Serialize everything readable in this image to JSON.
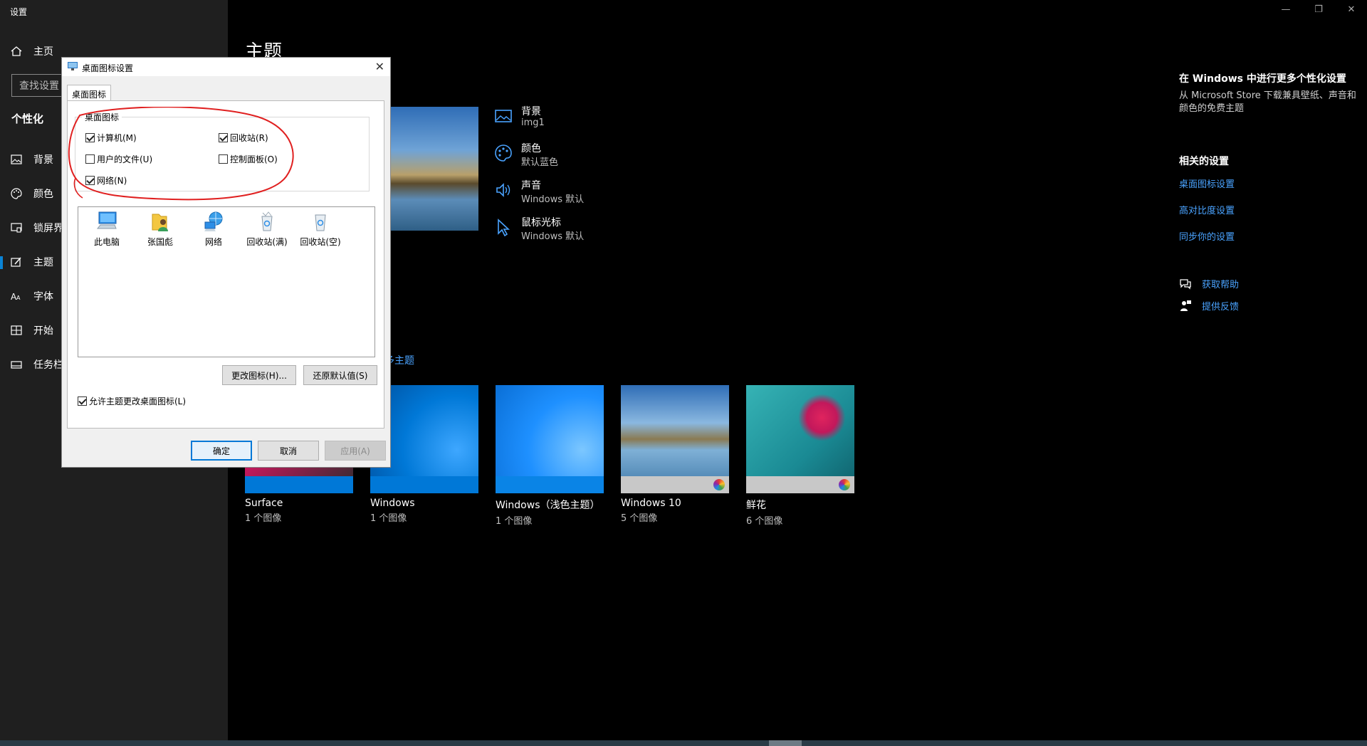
{
  "window": {
    "app_title": "设置",
    "controls": {
      "minimize": "—",
      "restore": "❐",
      "close": "✕"
    }
  },
  "sidebar": {
    "home": "主页",
    "search_placeholder": "查找设置",
    "section_title": "个性化",
    "items": [
      {
        "label": "背景",
        "icon": "picture-icon"
      },
      {
        "label": "颜色",
        "icon": "palette-icon"
      },
      {
        "label": "锁屏界",
        "icon": "lockscreen-icon"
      },
      {
        "label": "主题",
        "icon": "theme-brush-icon",
        "active": true
      },
      {
        "label": "字体",
        "icon": "font-icon"
      },
      {
        "label": "开始",
        "icon": "start-icon"
      },
      {
        "label": "任务栏",
        "icon": "taskbar-icon"
      }
    ]
  },
  "main": {
    "page_title": "主题",
    "properties": [
      {
        "title": "背景",
        "value": "img1",
        "icon": "picture-icon"
      },
      {
        "title": "颜色",
        "value": "默认蓝色",
        "icon": "palette-icon"
      },
      {
        "title": "声音",
        "value": "Windows 默认",
        "icon": "speaker-icon"
      },
      {
        "title": "鼠标光标",
        "value": "Windows 默认",
        "icon": "cursor-icon"
      }
    ],
    "more_themes_link": "多主题",
    "themes": [
      {
        "name": "Surface",
        "count": "1 个图像"
      },
      {
        "name": "Windows",
        "count": "1 个图像"
      },
      {
        "name": "Windows（浅色主题）",
        "count": "1 个图像"
      },
      {
        "name": "Windows 10",
        "count": "5 个图像"
      },
      {
        "name": "鲜花",
        "count": "6 个图像"
      }
    ]
  },
  "right_panel": {
    "promo_title": "在 Windows 中进行更多个性化设置",
    "promo_text": "从 Microsoft Store 下载兼具壁纸、声音和颜色的免费主题",
    "related_title": "相关的设置",
    "related_links": [
      "桌面图标设置",
      "高对比度设置",
      "同步你的设置"
    ],
    "help": "获取帮助",
    "feedback": "提供反馈"
  },
  "dialog": {
    "title": "桌面图标设置",
    "tab": "桌面图标",
    "group_label": "桌面图标",
    "checkboxes": [
      {
        "label": "计算机(M)",
        "checked": true
      },
      {
        "label": "回收站(R)",
        "checked": true
      },
      {
        "label": "用户的文件(U)",
        "checked": false
      },
      {
        "label": "控制面板(O)",
        "checked": false
      },
      {
        "label": "网络(N)",
        "checked": true
      }
    ],
    "icons": [
      {
        "label": "此电脑",
        "icon": "this-pc-icon"
      },
      {
        "label": "张国彪",
        "icon": "user-folder-icon"
      },
      {
        "label": "网络",
        "icon": "network-icon"
      },
      {
        "label": "回收站(满)",
        "icon": "recycle-bin-full-icon"
      },
      {
        "label": "回收站(空)",
        "icon": "recycle-bin-empty-icon"
      }
    ],
    "change_icon_button": "更改图标(H)...",
    "restore_default_button": "还原默认值(S)",
    "allow_themes_checkbox": {
      "label": "允许主题更改桌面图标(L)",
      "checked": true
    },
    "ok_button": "确定",
    "cancel_button": "取消",
    "apply_button": "应用(A)"
  },
  "colors": {
    "accent": "#0078d7",
    "link": "#4aa3ff",
    "annotation": "#e02020"
  }
}
